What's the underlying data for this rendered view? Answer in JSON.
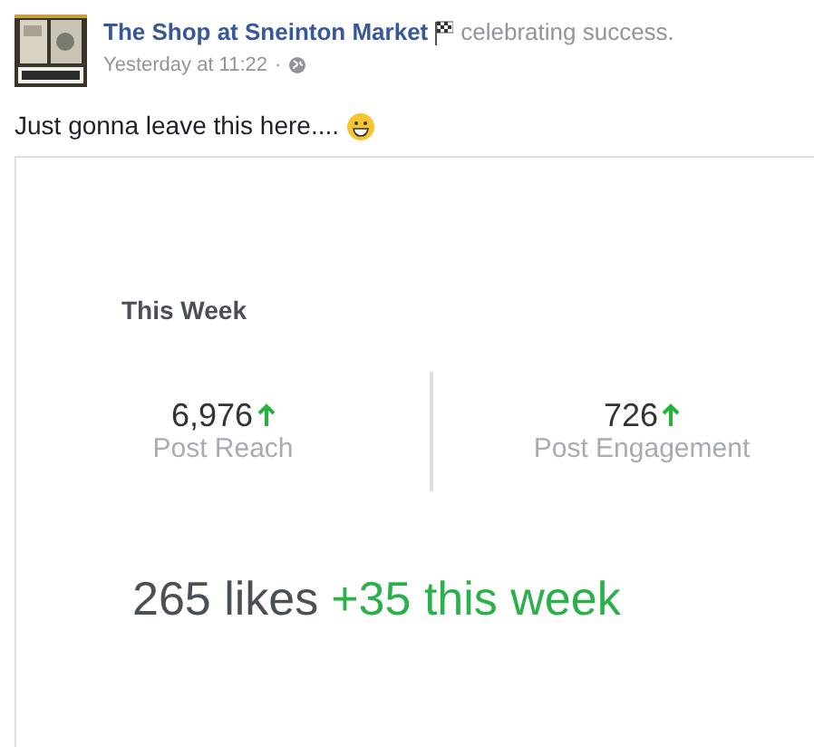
{
  "post": {
    "author": "The Shop at Sneinton Market",
    "activity": "celebrating success.",
    "time": "Yesterday at 11:22",
    "separator": "·",
    "text": "Just gonna leave this here...."
  },
  "card": {
    "title": "This Week",
    "stats": [
      {
        "value": "6,976",
        "label": "Post Reach",
        "kind": "rising"
      },
      {
        "value": "726",
        "label": "Post Engagement",
        "kind": "rising"
      }
    ],
    "likes": "265 likes",
    "change": "+35 this week"
  }
}
